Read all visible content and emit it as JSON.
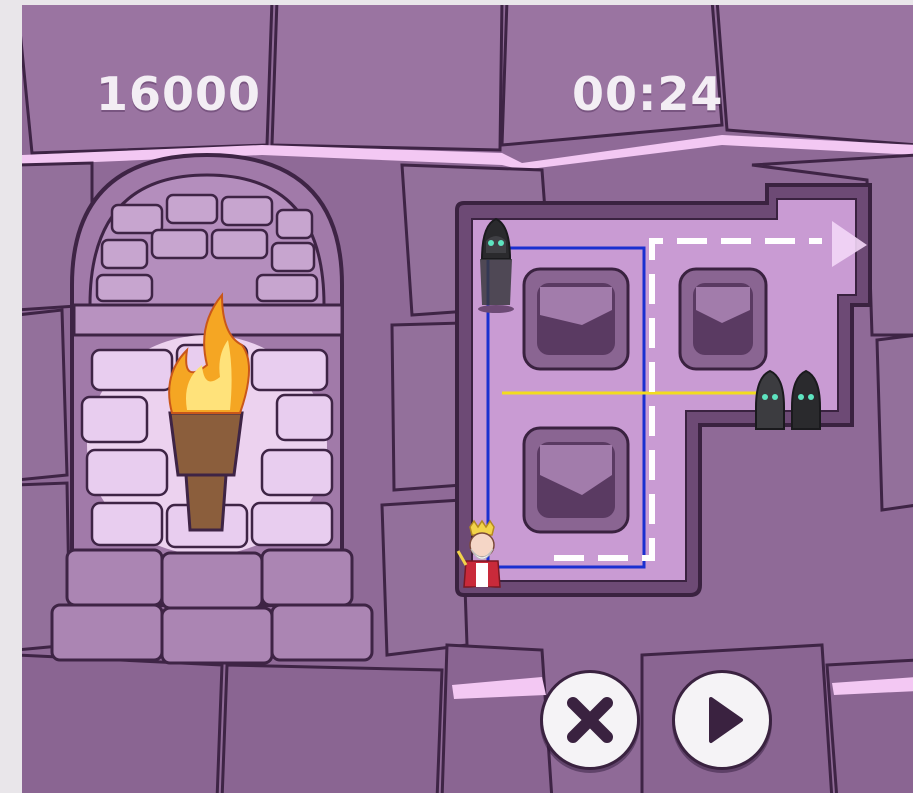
{
  "hud": {
    "score": "16000",
    "timer": "00:24"
  },
  "controls": {
    "cancel_icon": "close-x-icon",
    "play_icon": "play-triangle-icon"
  },
  "colors": {
    "wall": "#8f6a97",
    "floor": "#c99bd3",
    "outline": "#3a2240",
    "guard_path": "#1a2fd0",
    "sight_line": "#f2dc1e",
    "planned_route": "#ffffff",
    "torch_flame": "#f5a623"
  }
}
